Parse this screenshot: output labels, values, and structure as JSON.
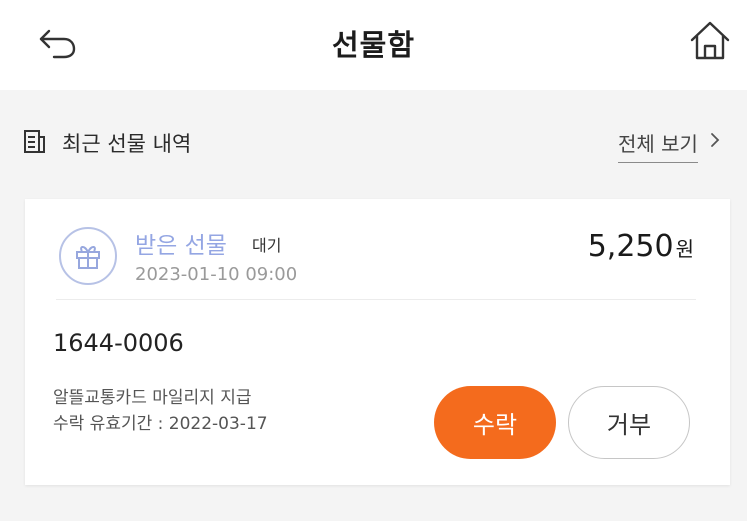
{
  "header": {
    "title": "선물함",
    "back_icon": "back-arrow-icon",
    "home_icon": "home-icon"
  },
  "recent": {
    "label": "최근 선물 내역",
    "view_all": "전체 보기",
    "icon": "list-document-icon"
  },
  "gift": {
    "type": "받은 선물",
    "status": "대기",
    "datetime": "2023-01-10 09:00",
    "amount": "5,250",
    "currency": "원",
    "sender": "1644-0006",
    "description": "알뜰교통카드 마일리지 지급",
    "expiry": "수락 유효기간 : 2022-03-17",
    "icon": "gift-icon",
    "accept_label": "수락",
    "reject_label": "거부"
  },
  "colors": {
    "accent": "#f46b1d",
    "gift_type": "#94a6e3",
    "background": "#f4f4f4"
  }
}
